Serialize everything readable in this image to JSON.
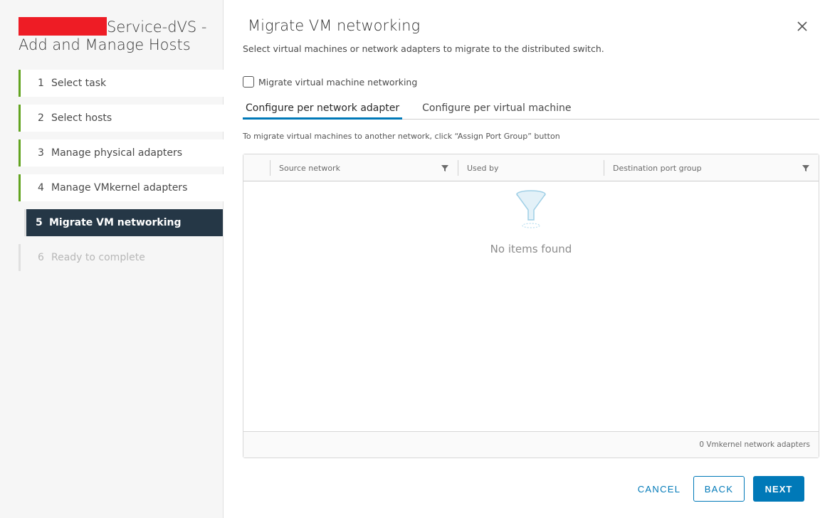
{
  "wizard": {
    "title": "Service-dVS - Add and Manage Hosts"
  },
  "steps": [
    {
      "num": "1",
      "label": "Select task",
      "state": "done"
    },
    {
      "num": "2",
      "label": "Select hosts",
      "state": "done"
    },
    {
      "num": "3",
      "label": "Manage physical adapters",
      "state": "done"
    },
    {
      "num": "4",
      "label": "Manage VMkernel adapters",
      "state": "done"
    },
    {
      "num": "5",
      "label": "Migrate VM networking",
      "state": "current"
    },
    {
      "num": "6",
      "label": "Ready to complete",
      "state": "pending"
    }
  ],
  "page": {
    "title": "Migrate VM networking",
    "subtitle": "Select virtual machines or network adapters to migrate to the distributed switch.",
    "checkbox_label": "Migrate virtual machine networking",
    "checkbox_checked": false,
    "tabs": [
      {
        "label": "Configure per network adapter",
        "active": true
      },
      {
        "label": "Configure per virtual machine",
        "active": false
      }
    ],
    "hint": "To migrate virtual machines to another network, click “Assign Port Group” button"
  },
  "grid": {
    "columns": [
      "Source network",
      "Used by",
      "Destination port group"
    ],
    "empty_text": "No items found",
    "footer": "0 Vmkernel network adapters"
  },
  "buttons": {
    "cancel": "CANCEL",
    "back": "BACK",
    "next": "NEXT"
  },
  "colors": {
    "accent": "#0079b8",
    "step_done": "#62a420",
    "step_current_bg": "#253746",
    "redaction": "#ee1c25"
  },
  "icons": {
    "close": "close-icon",
    "filter": "filter-icon",
    "empty": "funnel-empty-icon"
  }
}
